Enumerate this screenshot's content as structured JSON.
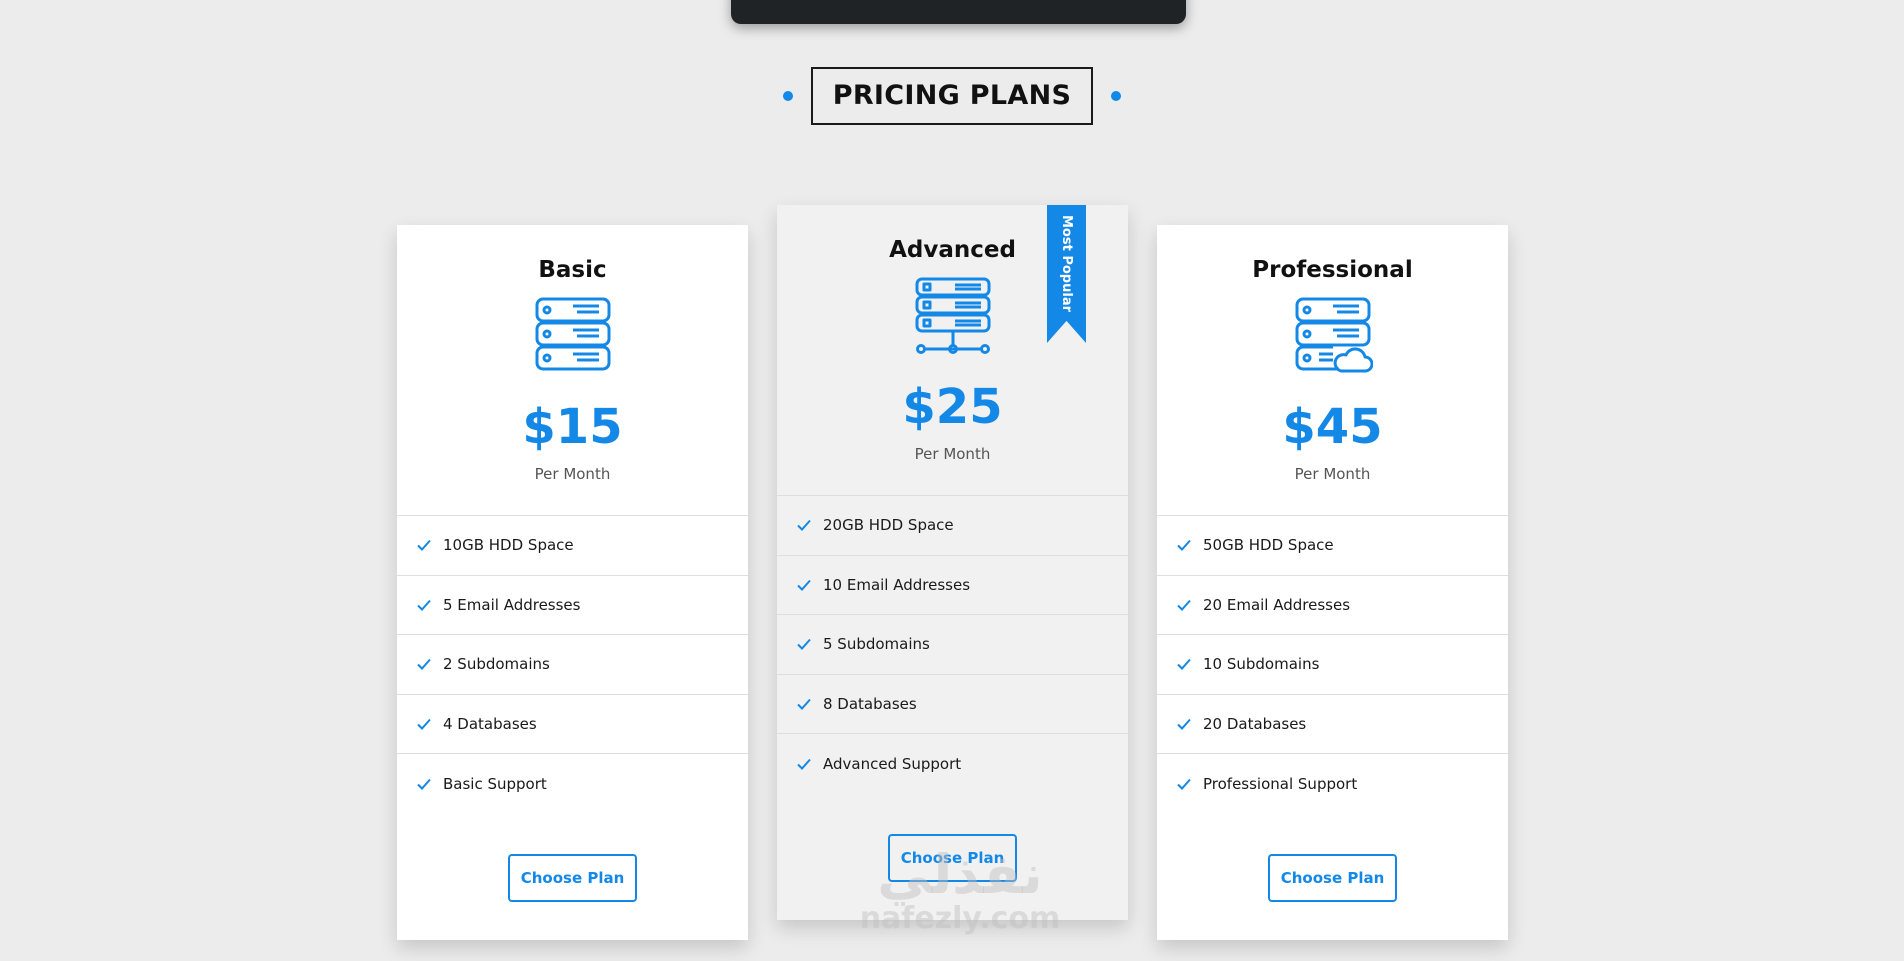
{
  "section": {
    "title": "PRICING PLANS",
    "accent_color": "#1488e6"
  },
  "plans": [
    {
      "name": "Basic",
      "icon": "server-stack-icon",
      "price": "$15",
      "period": "Per Month",
      "features": [
        "10GB HDD Space",
        "5 Email Addresses",
        "2 Subdomains",
        "4 Databases",
        "Basic Support"
      ],
      "button_label": "Choose Plan"
    },
    {
      "name": "Advanced",
      "icon": "server-network-icon",
      "price": "$25",
      "period": "Per Month",
      "badge": "Most Popular",
      "features": [
        "20GB HDD Space",
        "10 Email Addresses",
        "5 Subdomains",
        "8 Databases",
        "Advanced Support"
      ],
      "button_label": "Choose Plan"
    },
    {
      "name": "Professional",
      "icon": "server-cloud-icon",
      "price": "$45",
      "period": "Per Month",
      "features": [
        "50GB HDD Space",
        "20 Email Addresses",
        "10 Subdomains",
        "20 Databases",
        "Professional Support"
      ],
      "button_label": "Choose Plan"
    }
  ],
  "watermark": {
    "arabic": "نفذلي",
    "latin": "nafezly.com"
  }
}
